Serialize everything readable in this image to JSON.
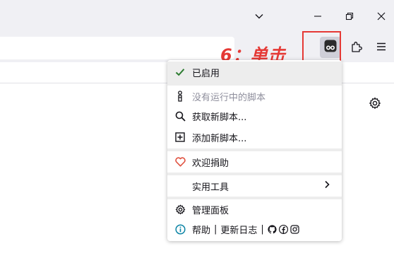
{
  "window": {
    "controls": [
      "chevron-down-icon",
      "minimize-icon",
      "restore-icon",
      "close-icon"
    ]
  },
  "annotation": {
    "text": "6：单击",
    "color": "#e53935"
  },
  "menu": {
    "enabled_label": "已启用",
    "no_scripts_label": "没有运行中的脚本",
    "get_scripts_label": "获取新脚本...",
    "add_script_label": "添加新脚本...",
    "donate_label": "欢迎捐助",
    "utilities_label": "实用工具",
    "dashboard_label": "管理面板",
    "help_label": "帮助",
    "separator": "|",
    "changelog_label": "更新日志"
  },
  "colors": {
    "check": "#2e7d32",
    "heart": "#e0513f",
    "info": "#0b84a5",
    "accent_box": "#e53935"
  }
}
